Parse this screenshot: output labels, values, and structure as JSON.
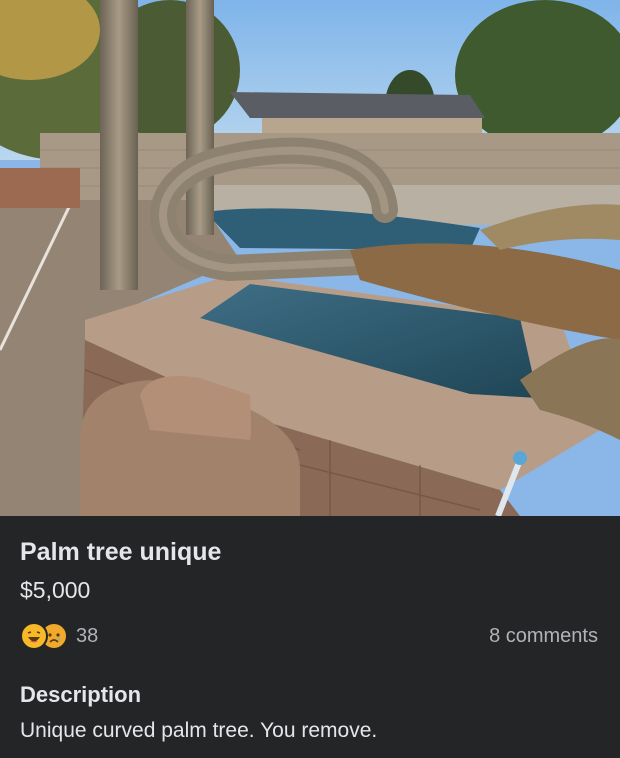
{
  "listing": {
    "image_description": "palm-tree-curved-over-pool",
    "title": "Palm tree unique",
    "price": "$5,000"
  },
  "engagement": {
    "reaction_icons": [
      "haha-icon",
      "sad-icon"
    ],
    "reaction_count": "38",
    "comments_label": "8 comments"
  },
  "description": {
    "heading": "Description",
    "text": "Unique curved palm tree. You remove."
  },
  "colors": {
    "background": "#242526",
    "primary_text": "#e4e6eb",
    "secondary_text": "#b0b3b8",
    "reaction_yellow": "#f7b928"
  }
}
